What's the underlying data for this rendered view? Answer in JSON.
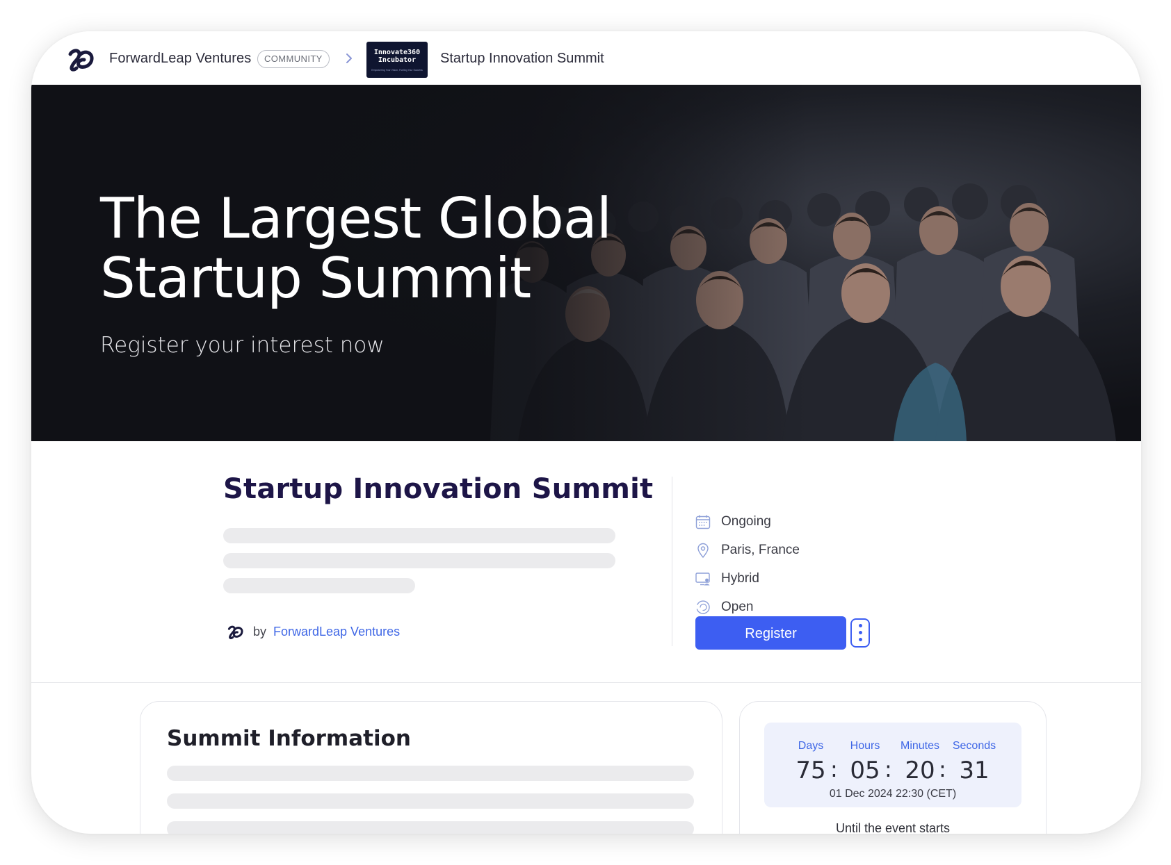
{
  "header": {
    "brand_name": "ForwardLeap Ventures",
    "badge": "COMMUNITY",
    "org_thumbnail": {
      "line1": "Innovate360",
      "line2": "Incubator",
      "tagline": "Empowering Your Vision, Fueling Your Success"
    },
    "current_page": "Startup Innovation Summit"
  },
  "hero": {
    "title": "The Largest Global Startup Summit",
    "subtitle": "Register your interest now"
  },
  "event": {
    "title": "Startup Innovation Summit",
    "by_label": "by",
    "organizer": "ForwardLeap Ventures"
  },
  "meta": {
    "status": "Ongoing",
    "location": "Paris, France",
    "format": "Hybrid",
    "access": "Open",
    "icons": [
      "calendar-icon",
      "location-pin-icon",
      "hybrid-monitor-icon",
      "open-circle-icon"
    ]
  },
  "actions": {
    "register_label": "Register"
  },
  "summit_info": {
    "heading": "Summit Information"
  },
  "countdown": {
    "labels": [
      "Days",
      "Hours",
      "Minutes",
      "Seconds"
    ],
    "values": [
      "75",
      "05",
      "20",
      "31"
    ],
    "separator": ":",
    "date": "01 Dec 2024 22:30 (CET)",
    "caption": "Until the event starts"
  },
  "colors": {
    "accent": "#3d5ef2",
    "link": "#3f67e6",
    "title_navy": "#1d1547",
    "hero_bg": "#111319"
  }
}
